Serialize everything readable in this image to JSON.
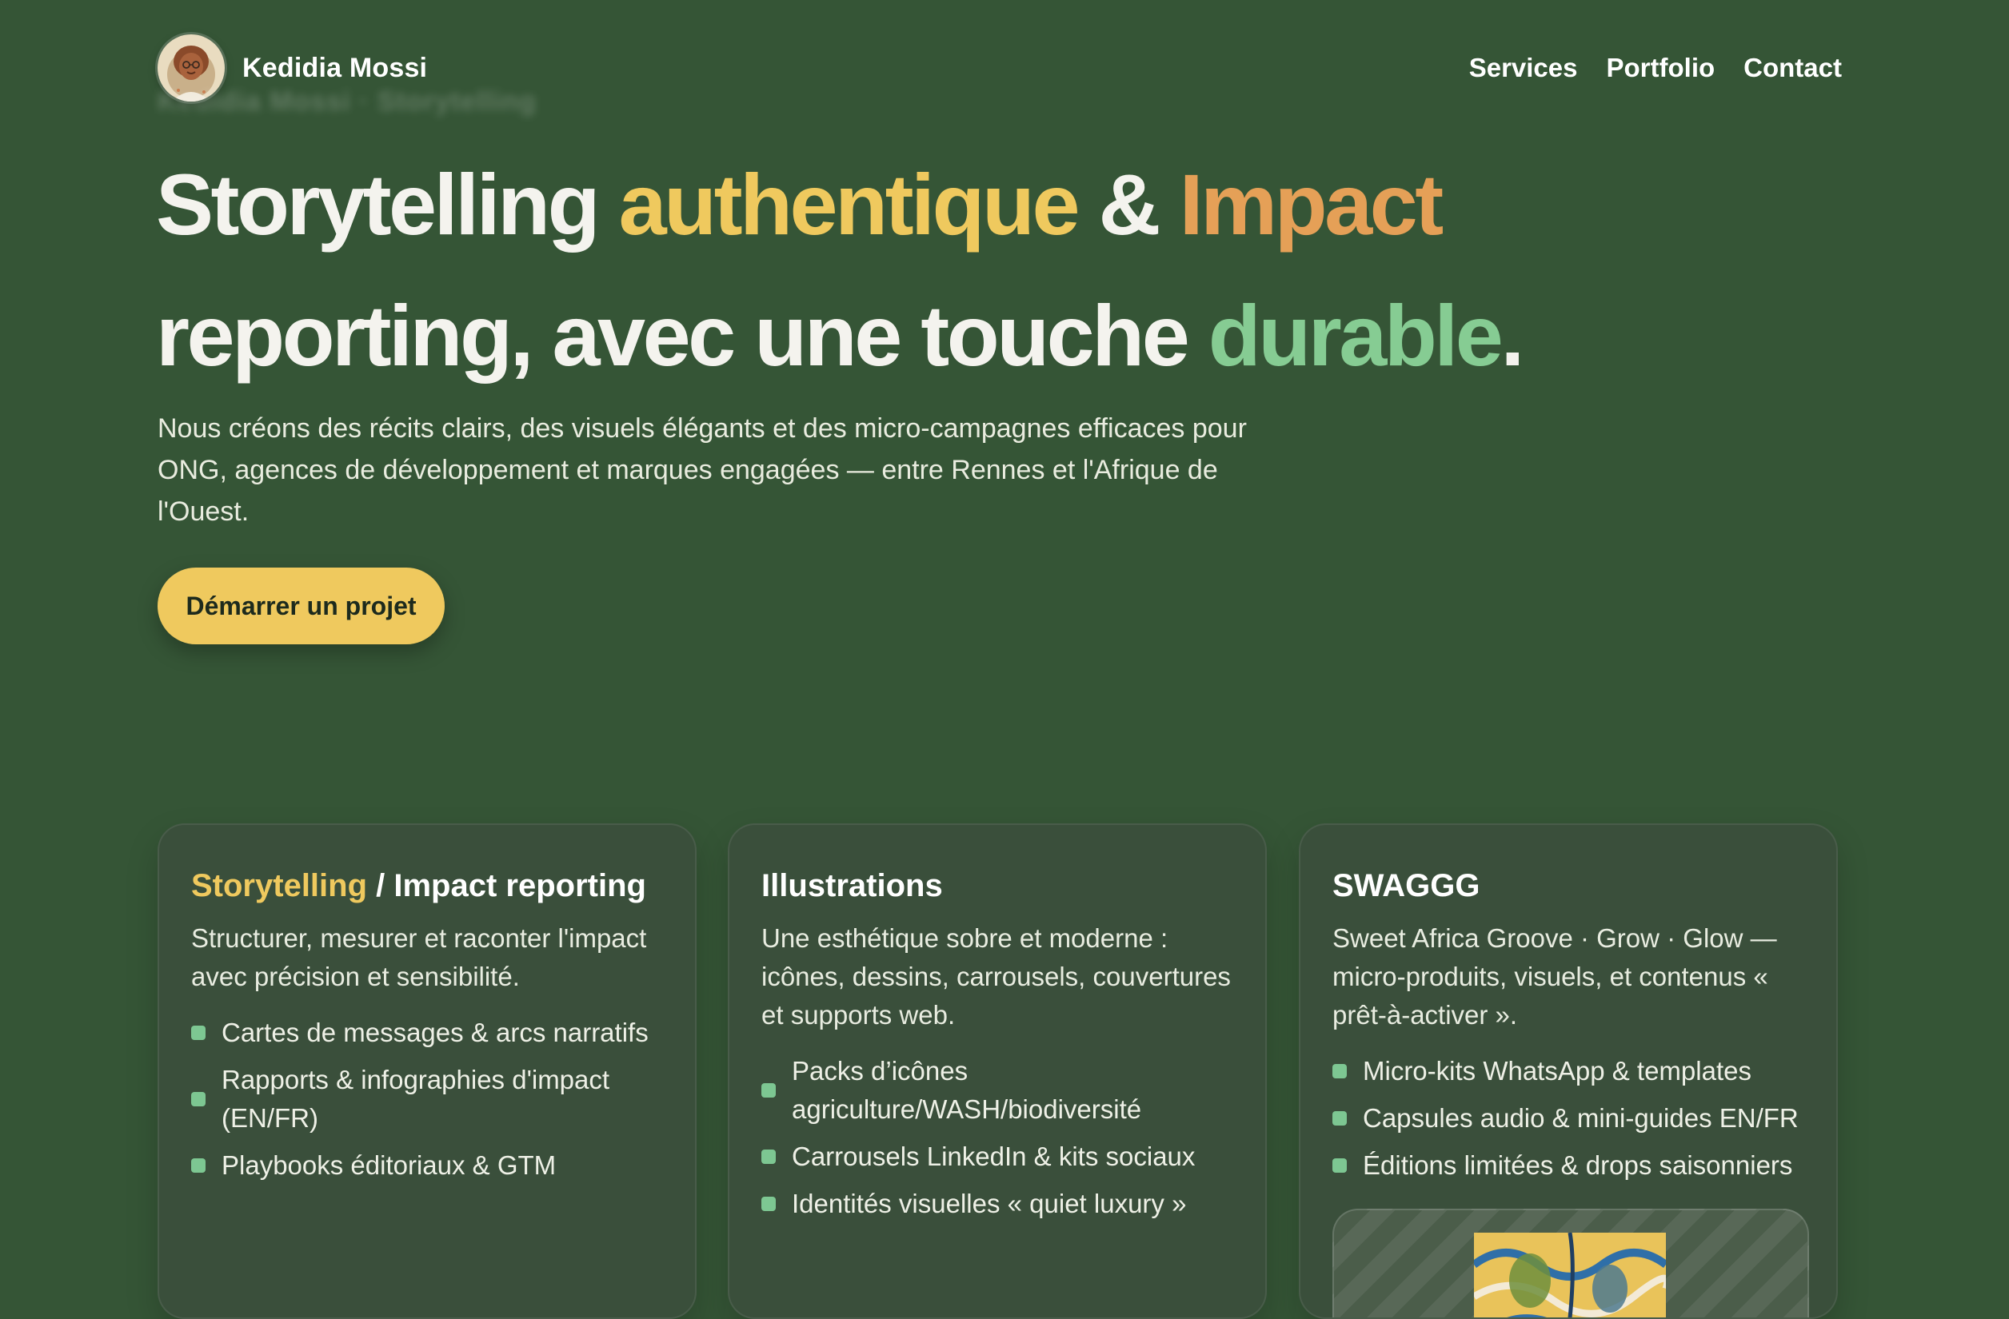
{
  "header": {
    "brand_name": "Kedidia Mossi",
    "avatar_icon": "portrait-avatar",
    "ghost_text": "Kedidia Mossi · Storytelling",
    "nav": [
      {
        "label": "Services"
      },
      {
        "label": "Portfolio"
      },
      {
        "label": "Contact"
      }
    ]
  },
  "hero": {
    "title": {
      "part1": "Storytelling ",
      "highlight1": "authentique",
      "part2": " & ",
      "highlight2": "Impact",
      "part3": " reporting, avec une touche ",
      "highlight3": "durable",
      "part4": "."
    },
    "lead": "Nous créons des récits clairs, des visuels élégants et des micro-campagnes efficaces pour ONG, agences de développement et marques engagées — entre Rennes et l'Afrique de l'Ouest.",
    "cta_label": "Démarrer un projet"
  },
  "cards": [
    {
      "title_highlight": "Storytelling",
      "title_rest": " / Impact reporting",
      "description": "Structurer, mesurer et raconter l'impact avec précision et sensibilité.",
      "items": [
        "Cartes de messages & arcs narratifs",
        "Rapports & infographies d'impact (EN/FR)",
        "Playbooks éditoriaux & GTM"
      ]
    },
    {
      "title": "Illustrations",
      "description": "Une esthétique sobre et moderne : icônes, dessins, carrousels, couvertures et supports web.",
      "items": [
        "Packs d’icônes agriculture/WASH/biodiversité",
        "Carrousels LinkedIn & kits sociaux",
        "Identités visuelles « quiet luxury »"
      ]
    },
    {
      "title": "SWAGGG",
      "description": "Sweet Africa Groove · Grow · Glow — micro-produits, visuels, et contenus « prêt-à-activer ».",
      "items": [
        "Micro-kits WhatsApp & templates",
        "Capsules audio & mini-guides EN/FR",
        "Éditions limitées & drops saisonniers"
      ],
      "image_icon": "product-illustration"
    }
  ],
  "colors": {
    "background": "#355536",
    "card_background": "#3a4f3b",
    "accent_yellow": "#efc95e",
    "accent_orange": "#e5a057",
    "accent_green": "#86cc93",
    "bullet_green": "#7dc792"
  }
}
